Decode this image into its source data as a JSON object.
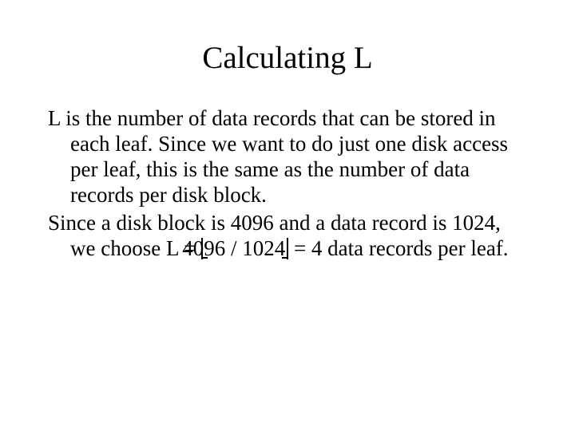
{
  "title": "Calculating L",
  "para1": "L is the number of data records that can be stored in each leaf.  Since we want to do just one disk access per leaf, this is the same as the number of data records per disk block.",
  "para2_pre": "Since a disk block is 4096 and a data record is 1024, we choose L = ",
  "floor_expr": "4096 / 1024",
  "para2_post": " = 4 data records per leaf."
}
